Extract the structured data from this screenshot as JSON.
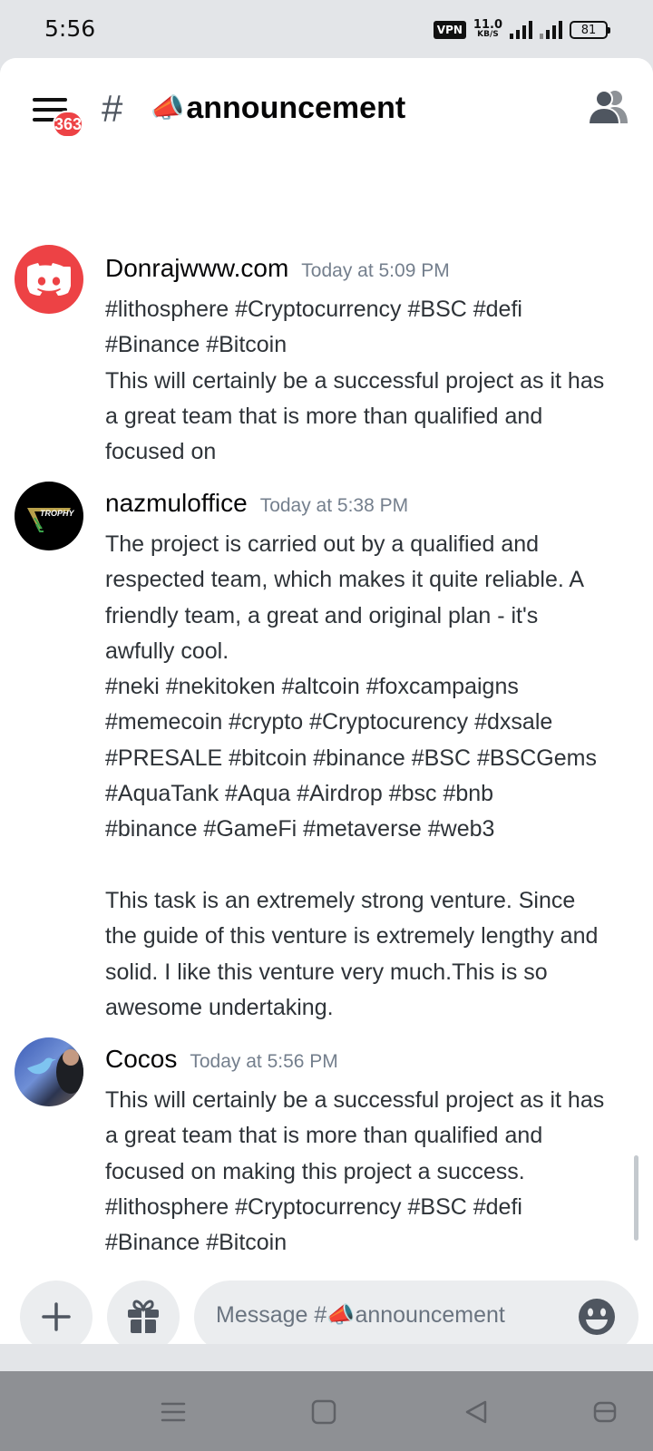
{
  "status_bar": {
    "time": "5:56",
    "vpn": "VPN",
    "net_speed_value": "11.0",
    "net_speed_unit": "KB/S",
    "battery": "81"
  },
  "header": {
    "hash": "#",
    "channel_emoji": "📣",
    "channel_name": "announcement",
    "unread_badge": "363"
  },
  "messages": {
    "cut_off_line": "#bnb #binance #GameFi #metaverse #web3",
    "items": [
      {
        "author": "Donrajwww.com",
        "time": "Today at 5:09 PM",
        "lines": [
          "#lithosphere #Cryptocurrency #BSC #defi",
          "#Binance #Bitcoin",
          "This will certainly be a successful project as it has",
          "a great team that is more than qualified and",
          "focused on"
        ]
      },
      {
        "author": "nazmuloffice",
        "time": "Today at 5:38 PM",
        "avatar_text": "TROPHY",
        "lines": [
          "The project is carried out by a qualified and",
          "respected team, which makes it quite reliable. A",
          "friendly team, a great and original plan - it's",
          "awfully cool.",
          "#neki #nekitoken #altcoin #foxcampaigns",
          "#memecoin #crypto #Cryptocurency #dxsale",
          "#PRESALE #bitcoin #binance #BSC #BSCGems",
          "#AquaTank #Aqua #Airdrop #bsc #bnb",
          "#binance #GameFi #metaverse #web3",
          "",
          "This task is an extremely strong venture. Since",
          "the guide of this venture is extremely lengthy and",
          "solid. I like this venture very much.This is so",
          "awesome undertaking."
        ]
      },
      {
        "author": "Cocos",
        "time": "Today at 5:56 PM",
        "lines": [
          "This will certainly be a successful project as it has",
          "a great team that is more than qualified and",
          "focused on making this project a success.",
          "#lithosphere #Cryptocurrency #BSC #defi",
          "#Binance #Bitcoin"
        ]
      }
    ]
  },
  "input": {
    "placeholder_prefix": "Message #",
    "placeholder_emoji": "📣",
    "placeholder_channel": "announcement"
  },
  "icons": {
    "menu": "hamburger-menu-icon",
    "members": "members-icon",
    "plus": "plus-icon",
    "gift": "gift-icon",
    "emoji": "emoji-icon"
  },
  "colors": {
    "badge": "#ed4245",
    "discord_avatar": "#ed4245",
    "timestamp": "#747f8d",
    "navbar": "#8e9094"
  }
}
